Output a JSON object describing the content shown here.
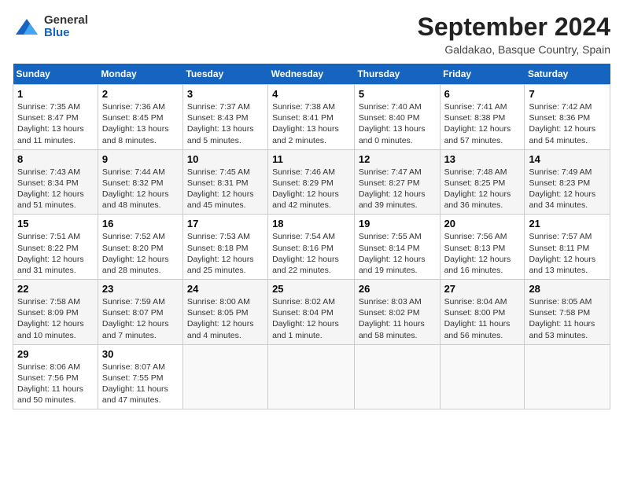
{
  "header": {
    "logo_line1": "General",
    "logo_line2": "Blue",
    "month_title": "September 2024",
    "location": "Galdakao, Basque Country, Spain"
  },
  "days_of_week": [
    "Sunday",
    "Monday",
    "Tuesday",
    "Wednesday",
    "Thursday",
    "Friday",
    "Saturday"
  ],
  "weeks": [
    [
      {
        "day": "1",
        "info": "Sunrise: 7:35 AM\nSunset: 8:47 PM\nDaylight: 13 hours and 11 minutes."
      },
      {
        "day": "2",
        "info": "Sunrise: 7:36 AM\nSunset: 8:45 PM\nDaylight: 13 hours and 8 minutes."
      },
      {
        "day": "3",
        "info": "Sunrise: 7:37 AM\nSunset: 8:43 PM\nDaylight: 13 hours and 5 minutes."
      },
      {
        "day": "4",
        "info": "Sunrise: 7:38 AM\nSunset: 8:41 PM\nDaylight: 13 hours and 2 minutes."
      },
      {
        "day": "5",
        "info": "Sunrise: 7:40 AM\nSunset: 8:40 PM\nDaylight: 13 hours and 0 minutes."
      },
      {
        "day": "6",
        "info": "Sunrise: 7:41 AM\nSunset: 8:38 PM\nDaylight: 12 hours and 57 minutes."
      },
      {
        "day": "7",
        "info": "Sunrise: 7:42 AM\nSunset: 8:36 PM\nDaylight: 12 hours and 54 minutes."
      }
    ],
    [
      {
        "day": "8",
        "info": "Sunrise: 7:43 AM\nSunset: 8:34 PM\nDaylight: 12 hours and 51 minutes."
      },
      {
        "day": "9",
        "info": "Sunrise: 7:44 AM\nSunset: 8:32 PM\nDaylight: 12 hours and 48 minutes."
      },
      {
        "day": "10",
        "info": "Sunrise: 7:45 AM\nSunset: 8:31 PM\nDaylight: 12 hours and 45 minutes."
      },
      {
        "day": "11",
        "info": "Sunrise: 7:46 AM\nSunset: 8:29 PM\nDaylight: 12 hours and 42 minutes."
      },
      {
        "day": "12",
        "info": "Sunrise: 7:47 AM\nSunset: 8:27 PM\nDaylight: 12 hours and 39 minutes."
      },
      {
        "day": "13",
        "info": "Sunrise: 7:48 AM\nSunset: 8:25 PM\nDaylight: 12 hours and 36 minutes."
      },
      {
        "day": "14",
        "info": "Sunrise: 7:49 AM\nSunset: 8:23 PM\nDaylight: 12 hours and 34 minutes."
      }
    ],
    [
      {
        "day": "15",
        "info": "Sunrise: 7:51 AM\nSunset: 8:22 PM\nDaylight: 12 hours and 31 minutes."
      },
      {
        "day": "16",
        "info": "Sunrise: 7:52 AM\nSunset: 8:20 PM\nDaylight: 12 hours and 28 minutes."
      },
      {
        "day": "17",
        "info": "Sunrise: 7:53 AM\nSunset: 8:18 PM\nDaylight: 12 hours and 25 minutes."
      },
      {
        "day": "18",
        "info": "Sunrise: 7:54 AM\nSunset: 8:16 PM\nDaylight: 12 hours and 22 minutes."
      },
      {
        "day": "19",
        "info": "Sunrise: 7:55 AM\nSunset: 8:14 PM\nDaylight: 12 hours and 19 minutes."
      },
      {
        "day": "20",
        "info": "Sunrise: 7:56 AM\nSunset: 8:13 PM\nDaylight: 12 hours and 16 minutes."
      },
      {
        "day": "21",
        "info": "Sunrise: 7:57 AM\nSunset: 8:11 PM\nDaylight: 12 hours and 13 minutes."
      }
    ],
    [
      {
        "day": "22",
        "info": "Sunrise: 7:58 AM\nSunset: 8:09 PM\nDaylight: 12 hours and 10 minutes."
      },
      {
        "day": "23",
        "info": "Sunrise: 7:59 AM\nSunset: 8:07 PM\nDaylight: 12 hours and 7 minutes."
      },
      {
        "day": "24",
        "info": "Sunrise: 8:00 AM\nSunset: 8:05 PM\nDaylight: 12 hours and 4 minutes."
      },
      {
        "day": "25",
        "info": "Sunrise: 8:02 AM\nSunset: 8:04 PM\nDaylight: 12 hours and 1 minute."
      },
      {
        "day": "26",
        "info": "Sunrise: 8:03 AM\nSunset: 8:02 PM\nDaylight: 11 hours and 58 minutes."
      },
      {
        "day": "27",
        "info": "Sunrise: 8:04 AM\nSunset: 8:00 PM\nDaylight: 11 hours and 56 minutes."
      },
      {
        "day": "28",
        "info": "Sunrise: 8:05 AM\nSunset: 7:58 PM\nDaylight: 11 hours and 53 minutes."
      }
    ],
    [
      {
        "day": "29",
        "info": "Sunrise: 8:06 AM\nSunset: 7:56 PM\nDaylight: 11 hours and 50 minutes."
      },
      {
        "day": "30",
        "info": "Sunrise: 8:07 AM\nSunset: 7:55 PM\nDaylight: 11 hours and 47 minutes."
      },
      null,
      null,
      null,
      null,
      null
    ]
  ]
}
